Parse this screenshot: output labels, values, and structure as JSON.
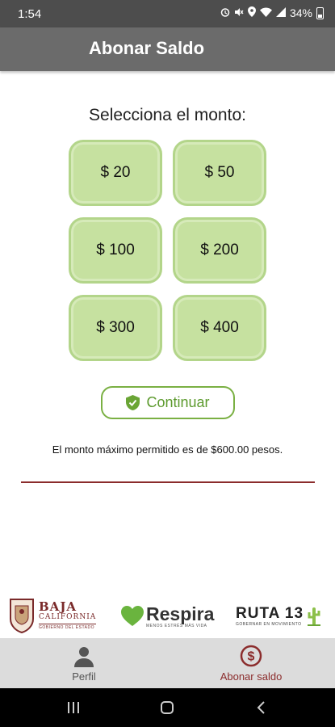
{
  "status_bar": {
    "time": "1:54",
    "battery": "34%",
    "icons": [
      "alarm-icon",
      "mute-icon",
      "location-icon",
      "wifi-icon",
      "signal-icon",
      "battery-icon"
    ]
  },
  "app_bar": {
    "title": "Abonar Saldo"
  },
  "main": {
    "prompt": "Selecciona el monto:",
    "amounts": [
      "$ 20",
      "$ 50",
      "$ 100",
      "$ 200",
      "$ 300",
      "$ 400"
    ],
    "continue_label": "Continuar",
    "max_note": "El monto máximo permitido es de $600.00 pesos."
  },
  "logos": {
    "baja": {
      "line1": "BAJA",
      "line2": "CALIFORNIA",
      "line3": "GOBIERNO DEL ESTADO"
    },
    "respira": {
      "word": "Respira",
      "sub": "MENOS ESTRÉS MÁS VIDA"
    },
    "ruta": {
      "word": "RUTA 13",
      "sub": "GOBERNAR EN MOVIMIENTO"
    }
  },
  "bottom_nav": {
    "items": [
      {
        "label": "Perfil",
        "icon": "person-icon",
        "active": false
      },
      {
        "label": "Abonar saldo",
        "icon": "dollar-circle-icon",
        "active": true
      }
    ]
  },
  "colors": {
    "status_bar": "#4d4d4d",
    "app_bar": "#6b6b6b",
    "amount_fill": "#c6e1a0",
    "accent_green": "#7ab043",
    "accent_maroon": "#8b2c2c"
  }
}
